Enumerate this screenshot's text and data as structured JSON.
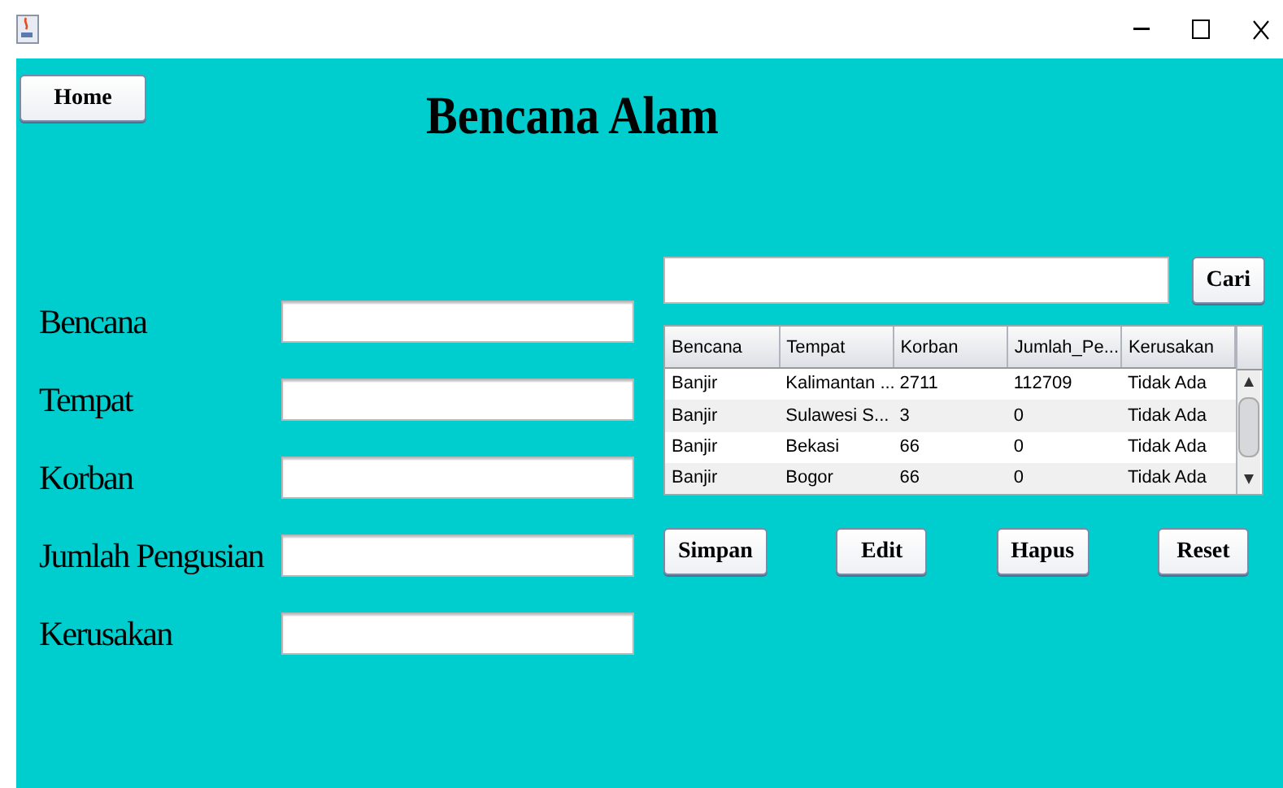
{
  "home_button": "Home",
  "title": "Bencana Alam",
  "form_fields": [
    {
      "label": "Bencana"
    },
    {
      "label": "Tempat"
    },
    {
      "label": "Korban"
    },
    {
      "label": "Jumlah Pengusian"
    },
    {
      "label": "Kerusakan"
    }
  ],
  "search_button": "Cari",
  "table": {
    "columns": [
      "Bencana",
      "Tempat",
      "Korban",
      "Jumlah_Pe...",
      "Kerusakan"
    ],
    "rows": [
      [
        "Banjir",
        "Kalimantan ...",
        "2711",
        "112709",
        "Tidak Ada"
      ],
      [
        "Banjir",
        "Sulawesi S...",
        "3",
        "0",
        "Tidak Ada"
      ],
      [
        "Banjir",
        "Bekasi",
        "66",
        "0",
        "Tidak Ada"
      ],
      [
        "Banjir",
        "Bogor",
        "66",
        "0",
        "Tidak Ada"
      ]
    ]
  },
  "action_buttons": [
    "Simpan",
    "Edit",
    "Hapus",
    "Reset"
  ]
}
